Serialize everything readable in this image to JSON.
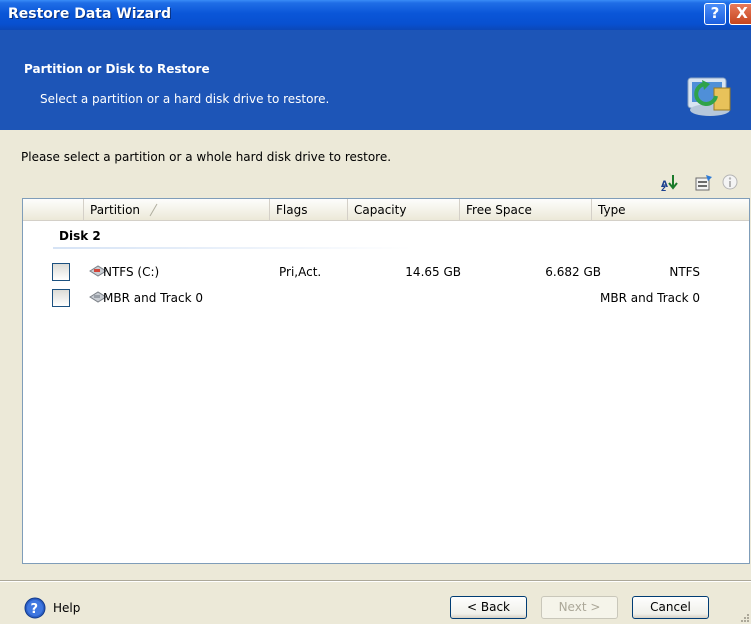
{
  "window": {
    "title": "Restore Data Wizard",
    "help_button": "?",
    "close_button": "X"
  },
  "header": {
    "title": "Partition or Disk to Restore",
    "subtitle": "Select a partition or a hard disk drive to restore."
  },
  "instruction": "Please select a partition or a whole hard disk drive to restore.",
  "toolbar_icons": [
    "sort-icon",
    "properties-icon",
    "info-icon"
  ],
  "table": {
    "columns": [
      "Partition",
      "Flags",
      "Capacity",
      "Free Space",
      "Type"
    ],
    "sort_column": "Partition",
    "group": "Disk 2",
    "rows": [
      {
        "checked": false,
        "name": "NTFS (C:)",
        "flags": "Pri,Act.",
        "capacity": "14.65 GB",
        "free_space": "6.682 GB",
        "type": "NTFS"
      },
      {
        "checked": false,
        "name": "MBR and Track 0",
        "flags": "",
        "capacity": "",
        "free_space": "",
        "type": "MBR and Track 0"
      }
    ]
  },
  "footer": {
    "help_label": "Help",
    "back_label": "< Back",
    "next_label": "Next >",
    "cancel_label": "Cancel",
    "next_enabled": false
  },
  "colors": {
    "titlebar": "#0a56d8",
    "header_band": "#1d55b7",
    "dialog_bg": "#ece9d8"
  }
}
